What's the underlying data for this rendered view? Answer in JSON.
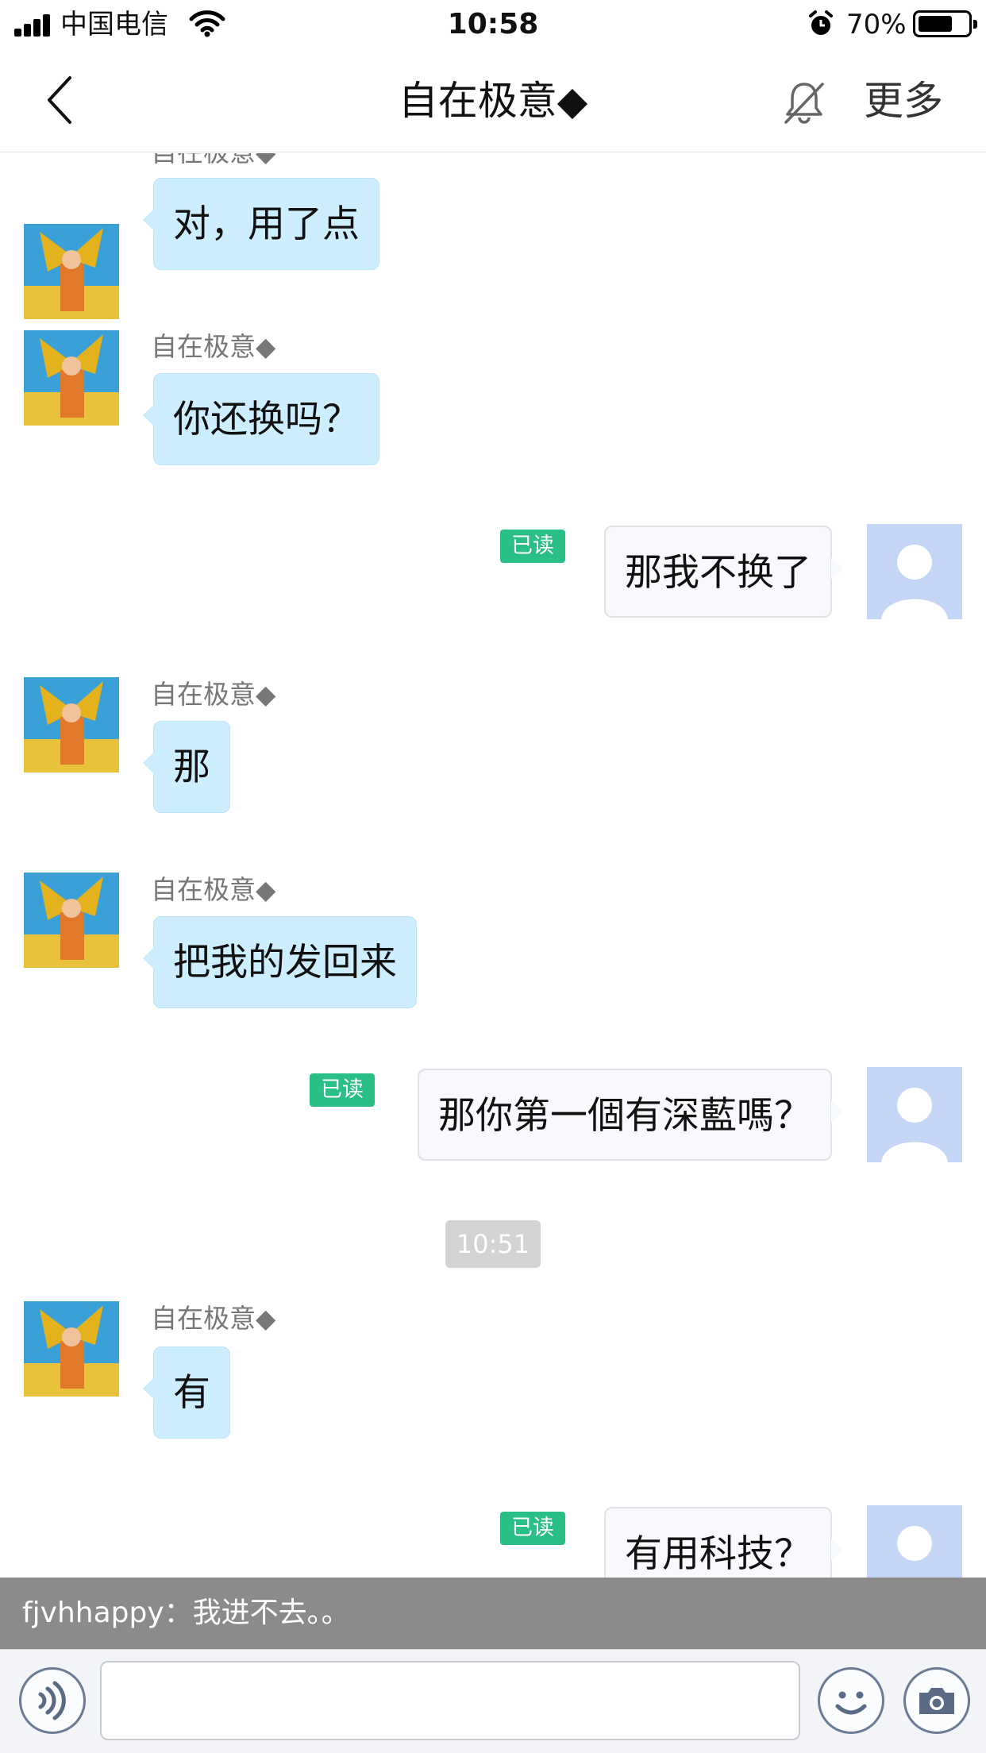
{
  "status_bar": {
    "carrier": "中国电信",
    "time": "10:58",
    "battery_percent": "70%",
    "battery_level": 0.7
  },
  "nav": {
    "title": "自在极意◆",
    "more_label": "更多",
    "back_icon": "chevron-left-icon",
    "mute_icon": "bell-muted-icon"
  },
  "messages": [
    {
      "direction": "in",
      "sender": "自在极意◆",
      "text": "对，用了点"
    },
    {
      "direction": "in",
      "sender": "自在极意◆",
      "text": "你还换吗？"
    },
    {
      "direction": "out",
      "text": "那我不换了",
      "status": "已读"
    },
    {
      "direction": "in",
      "sender": "自在极意◆",
      "text": "那"
    },
    {
      "direction": "in",
      "sender": "自在极意◆",
      "text": "把我的发回来"
    },
    {
      "direction": "out",
      "text": "那你第一個有深藍嗎？",
      "status": "已读"
    },
    {
      "type": "time",
      "text": "10:51"
    },
    {
      "direction": "in",
      "sender": "自在极意◆",
      "text": "有"
    },
    {
      "direction": "out",
      "text": "有用科技？",
      "status": "已读"
    }
  ],
  "notification": {
    "text": "fjvhhappy：我进不去。。"
  },
  "input_bar": {
    "text_value": "",
    "voice_icon": "voice-icon",
    "emoji_icon": "emoji-icon",
    "camera_icon": "camera-icon"
  },
  "colors": {
    "incoming_bubble": "#cdeefe",
    "outgoing_bubble": "#f8f9fc",
    "read_badge": "#29bf86",
    "outgoing_avatar": "#c4d5f6"
  }
}
